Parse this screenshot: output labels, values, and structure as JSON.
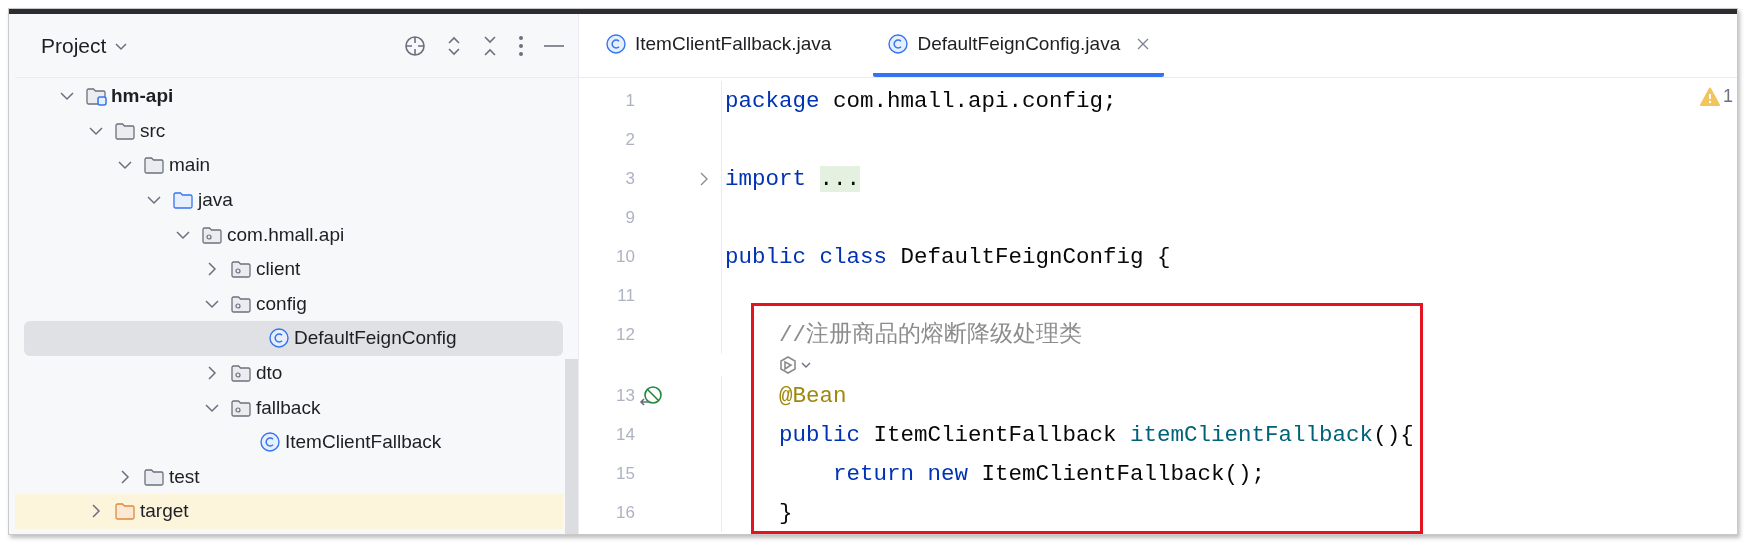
{
  "project_panel": {
    "title": "Project",
    "tree": [
      {
        "label": "hm-api",
        "kind": "module",
        "expanded": true,
        "selected": false,
        "children": [
          {
            "label": "src",
            "kind": "folder",
            "expanded": true,
            "selected": false,
            "children": [
              {
                "label": "main",
                "kind": "folder",
                "expanded": true,
                "selected": false,
                "children": [
                  {
                    "label": "java",
                    "kind": "source-root",
                    "expanded": true,
                    "selected": false,
                    "children": [
                      {
                        "label": "com.hmall.api",
                        "kind": "package",
                        "expanded": true,
                        "selected": false,
                        "children": [
                          {
                            "label": "client",
                            "kind": "package",
                            "expanded": false,
                            "selected": false
                          },
                          {
                            "label": "config",
                            "kind": "package",
                            "expanded": true,
                            "selected": false,
                            "children": [
                              {
                                "label": "DefaultFeignConfig",
                                "kind": "class",
                                "selected": true
                              }
                            ]
                          },
                          {
                            "label": "dto",
                            "kind": "package",
                            "expanded": false,
                            "selected": false
                          },
                          {
                            "label": "fallback",
                            "kind": "package",
                            "expanded": true,
                            "selected": false,
                            "children": [
                              {
                                "label": "ItemClientFallback",
                                "kind": "class",
                                "selected": false
                              }
                            ]
                          }
                        ]
                      }
                    ]
                  }
                ]
              },
              {
                "label": "test",
                "kind": "folder",
                "expanded": false,
                "selected": false
              }
            ]
          },
          {
            "label": "target",
            "kind": "excluded-folder",
            "expanded": false,
            "selected": false
          }
        ]
      }
    ]
  },
  "editor": {
    "tabs": [
      {
        "label": "ItemClientFallback.java",
        "selected": false
      },
      {
        "label": "DefaultFeignConfig.java",
        "selected": true
      }
    ],
    "warnings": "1",
    "lines": [
      {
        "number": "1",
        "tokens": [
          {
            "kind": "keyword",
            "text": "package"
          },
          {
            "kind": "plain",
            "text": " com.hmall.api.config;"
          }
        ]
      },
      {
        "number": "2"
      },
      {
        "number": "3",
        "folded": true,
        "tokens": [
          {
            "kind": "keyword",
            "text": "import"
          },
          {
            "kind": "folded",
            "text": "..."
          }
        ]
      },
      {
        "number": "9"
      },
      {
        "number": "10",
        "tokens": [
          {
            "kind": "keyword",
            "text": "public"
          },
          {
            "kind": "keyword",
            "text": "class"
          },
          {
            "kind": "plain",
            "text": " DefaultFeignConfig {"
          }
        ]
      },
      {
        "number": "11"
      }
    ],
    "boxed_lines": [
      {
        "number": "12",
        "inlay_hint": true,
        "tokens": [
          {
            "kind": "comment",
            "text": "    //注册商品的熔断降级处理类"
          }
        ]
      },
      {
        "number": "13",
        "bean_marker": true,
        "tokens": [
          {
            "kind": "annotation",
            "text": "    @Bean"
          }
        ]
      },
      {
        "number": "14",
        "tokens": [
          {
            "kind": "keyword",
            "text": "    public"
          },
          {
            "kind": "plain",
            "text": " ItemClientFallback "
          },
          {
            "kind": "method",
            "text": "itemClientFallback"
          },
          {
            "kind": "plain",
            "text": "(){"
          }
        ]
      },
      {
        "number": "15",
        "tokens": [
          {
            "kind": "keyword",
            "text": "        return"
          },
          {
            "kind": "keyword",
            "text": "new"
          },
          {
            "kind": "plain",
            "text": " ItemClientFallback();"
          }
        ]
      },
      {
        "number": "16",
        "tokens": [
          {
            "kind": "plain",
            "text": "    }"
          }
        ]
      }
    ]
  }
}
